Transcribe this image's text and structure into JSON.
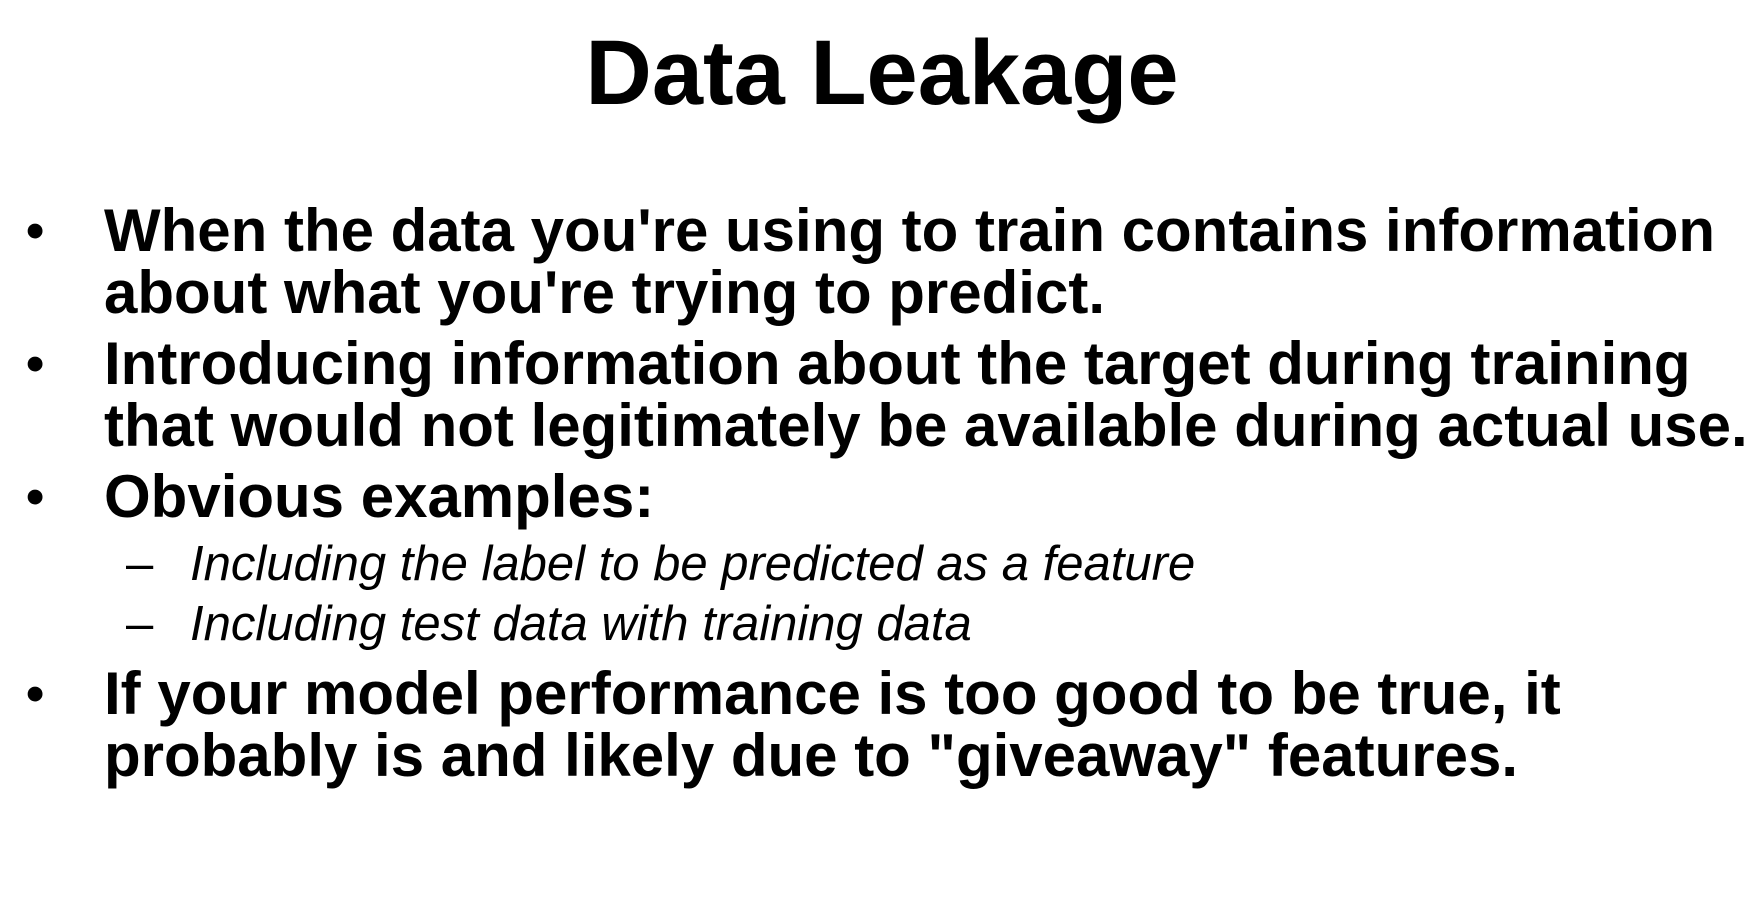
{
  "slide": {
    "title": "Data Leakage",
    "bullets": [
      {
        "marker": "•",
        "text": "When the data you're using to train contains information about what you're trying to predict."
      },
      {
        "marker": "•",
        "text": "Introducing information about the target during training that would not legitimately be available during actual use."
      },
      {
        "marker": "•",
        "text": "Obvious examples:",
        "sub_items": [
          {
            "marker": "–",
            "text": "Including the label to be predicted as a feature"
          },
          {
            "marker": "–",
            "text": "Including test data with training data"
          }
        ]
      },
      {
        "marker": "•",
        "text": "If your model performance is too good to be true, it probably is and likely due to \"giveaway\" features."
      }
    ]
  }
}
